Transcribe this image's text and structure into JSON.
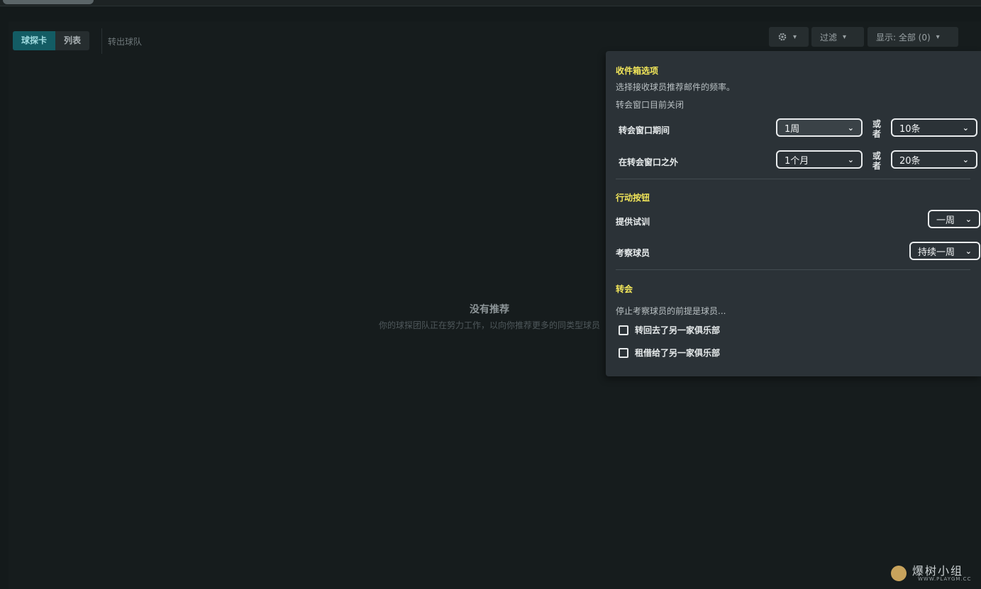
{
  "tabs": {
    "card": "球探卡",
    "list": "列表"
  },
  "out_link": "转出球队",
  "toolbar": {
    "gear_chev": "⌄",
    "filter": "过滤",
    "show": "显示: 全部 (0)"
  },
  "empty": {
    "title": "没有推荐",
    "subtitle": "你的球探团队正在努力工作，以向你推荐更多的同类型球员"
  },
  "panel": {
    "inbox": {
      "title": "收件箱选项",
      "desc": "选择接收球员推荐邮件的频率。",
      "status": "转会窗口目前关闭",
      "rows": [
        {
          "label": "转会窗口期间",
          "period": "1周",
          "or_1": "或",
          "or_2": "者",
          "count": "10条"
        },
        {
          "label": "在转会窗口之外",
          "period": "1个月",
          "or_1": "或",
          "or_2": "者",
          "count": "20条"
        }
      ]
    },
    "actions": {
      "title": "行动按钮",
      "trial_label": "提供试训",
      "trial_value": "一周",
      "scout_label": "考察球员",
      "scout_value": "持续一周"
    },
    "transfer": {
      "title": "转会",
      "desc": "停止考察球员的前提是球员...",
      "options": [
        {
          "label": "转回去了另一家俱乐部",
          "checked": false
        },
        {
          "label": "租借给了另一家俱乐部",
          "checked": false
        }
      ]
    }
  },
  "watermark": {
    "name": "爆树小组",
    "url": "WWW.PLAYGM.CC"
  }
}
